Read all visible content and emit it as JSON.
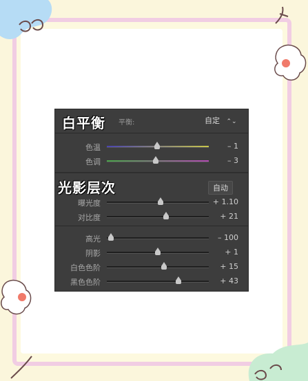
{
  "colors": {
    "background": "#fbf6dc",
    "frame_border": "#f1cde3",
    "panel_bg": "#3d3d3d",
    "temp_track_from": "#4a44b0",
    "temp_track_to": "#c9c74a",
    "tint_track_from": "#4aa64a",
    "tint_track_to": "#b44ab4"
  },
  "white_balance": {
    "title": "白平衡",
    "label_prefix": "平衡:",
    "preset_value": "自定",
    "preset_icon": "chevron-updown-icon",
    "sliders": [
      {
        "label": "色温",
        "value": "– 1",
        "position": 0.49
      },
      {
        "label": "色调",
        "value": "– 3",
        "position": 0.48
      }
    ]
  },
  "tone": {
    "title": "光影层次",
    "auto_label": "自动",
    "sliders_a": [
      {
        "label": "曝光度",
        "value": "+ 1.10",
        "position": 0.53
      },
      {
        "label": "对比度",
        "value": "+ 21",
        "position": 0.58
      }
    ],
    "sliders_b": [
      {
        "label": "高光",
        "value": "– 100",
        "position": 0.04
      },
      {
        "label": "阴影",
        "value": "+ 1",
        "position": 0.5
      },
      {
        "label": "白色色阶",
        "value": "+ 15",
        "position": 0.56
      },
      {
        "label": "黑色色阶",
        "value": "+ 43",
        "position": 0.7
      }
    ]
  }
}
